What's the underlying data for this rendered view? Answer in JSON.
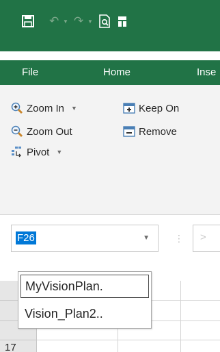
{
  "quick_access": {
    "icons": [
      "save-icon",
      "undo-icon",
      "redo-icon",
      "print-preview-icon",
      "customize-icon"
    ]
  },
  "tabs": [
    {
      "label": "File"
    },
    {
      "label": "Home"
    },
    {
      "label": "Inse"
    }
  ],
  "ribbon": {
    "zoom_in": "Zoom In",
    "zoom_out": "Zoom Out",
    "pivot": "Pivot",
    "keep_only": "Keep On",
    "remove": "Remove"
  },
  "name_box": {
    "value": "F26"
  },
  "formula_bar": {
    "separator": "⋮",
    "cancel": ">"
  },
  "dropdown": {
    "items": [
      {
        "label": "MyVisionPlan."
      },
      {
        "label": "Vision_Plan2.."
      }
    ]
  },
  "grid": {
    "row_header": "17"
  },
  "colors": {
    "accent": "#217346",
    "selection": "#0078d7",
    "ribbon_bg": "#f3f3f3"
  }
}
